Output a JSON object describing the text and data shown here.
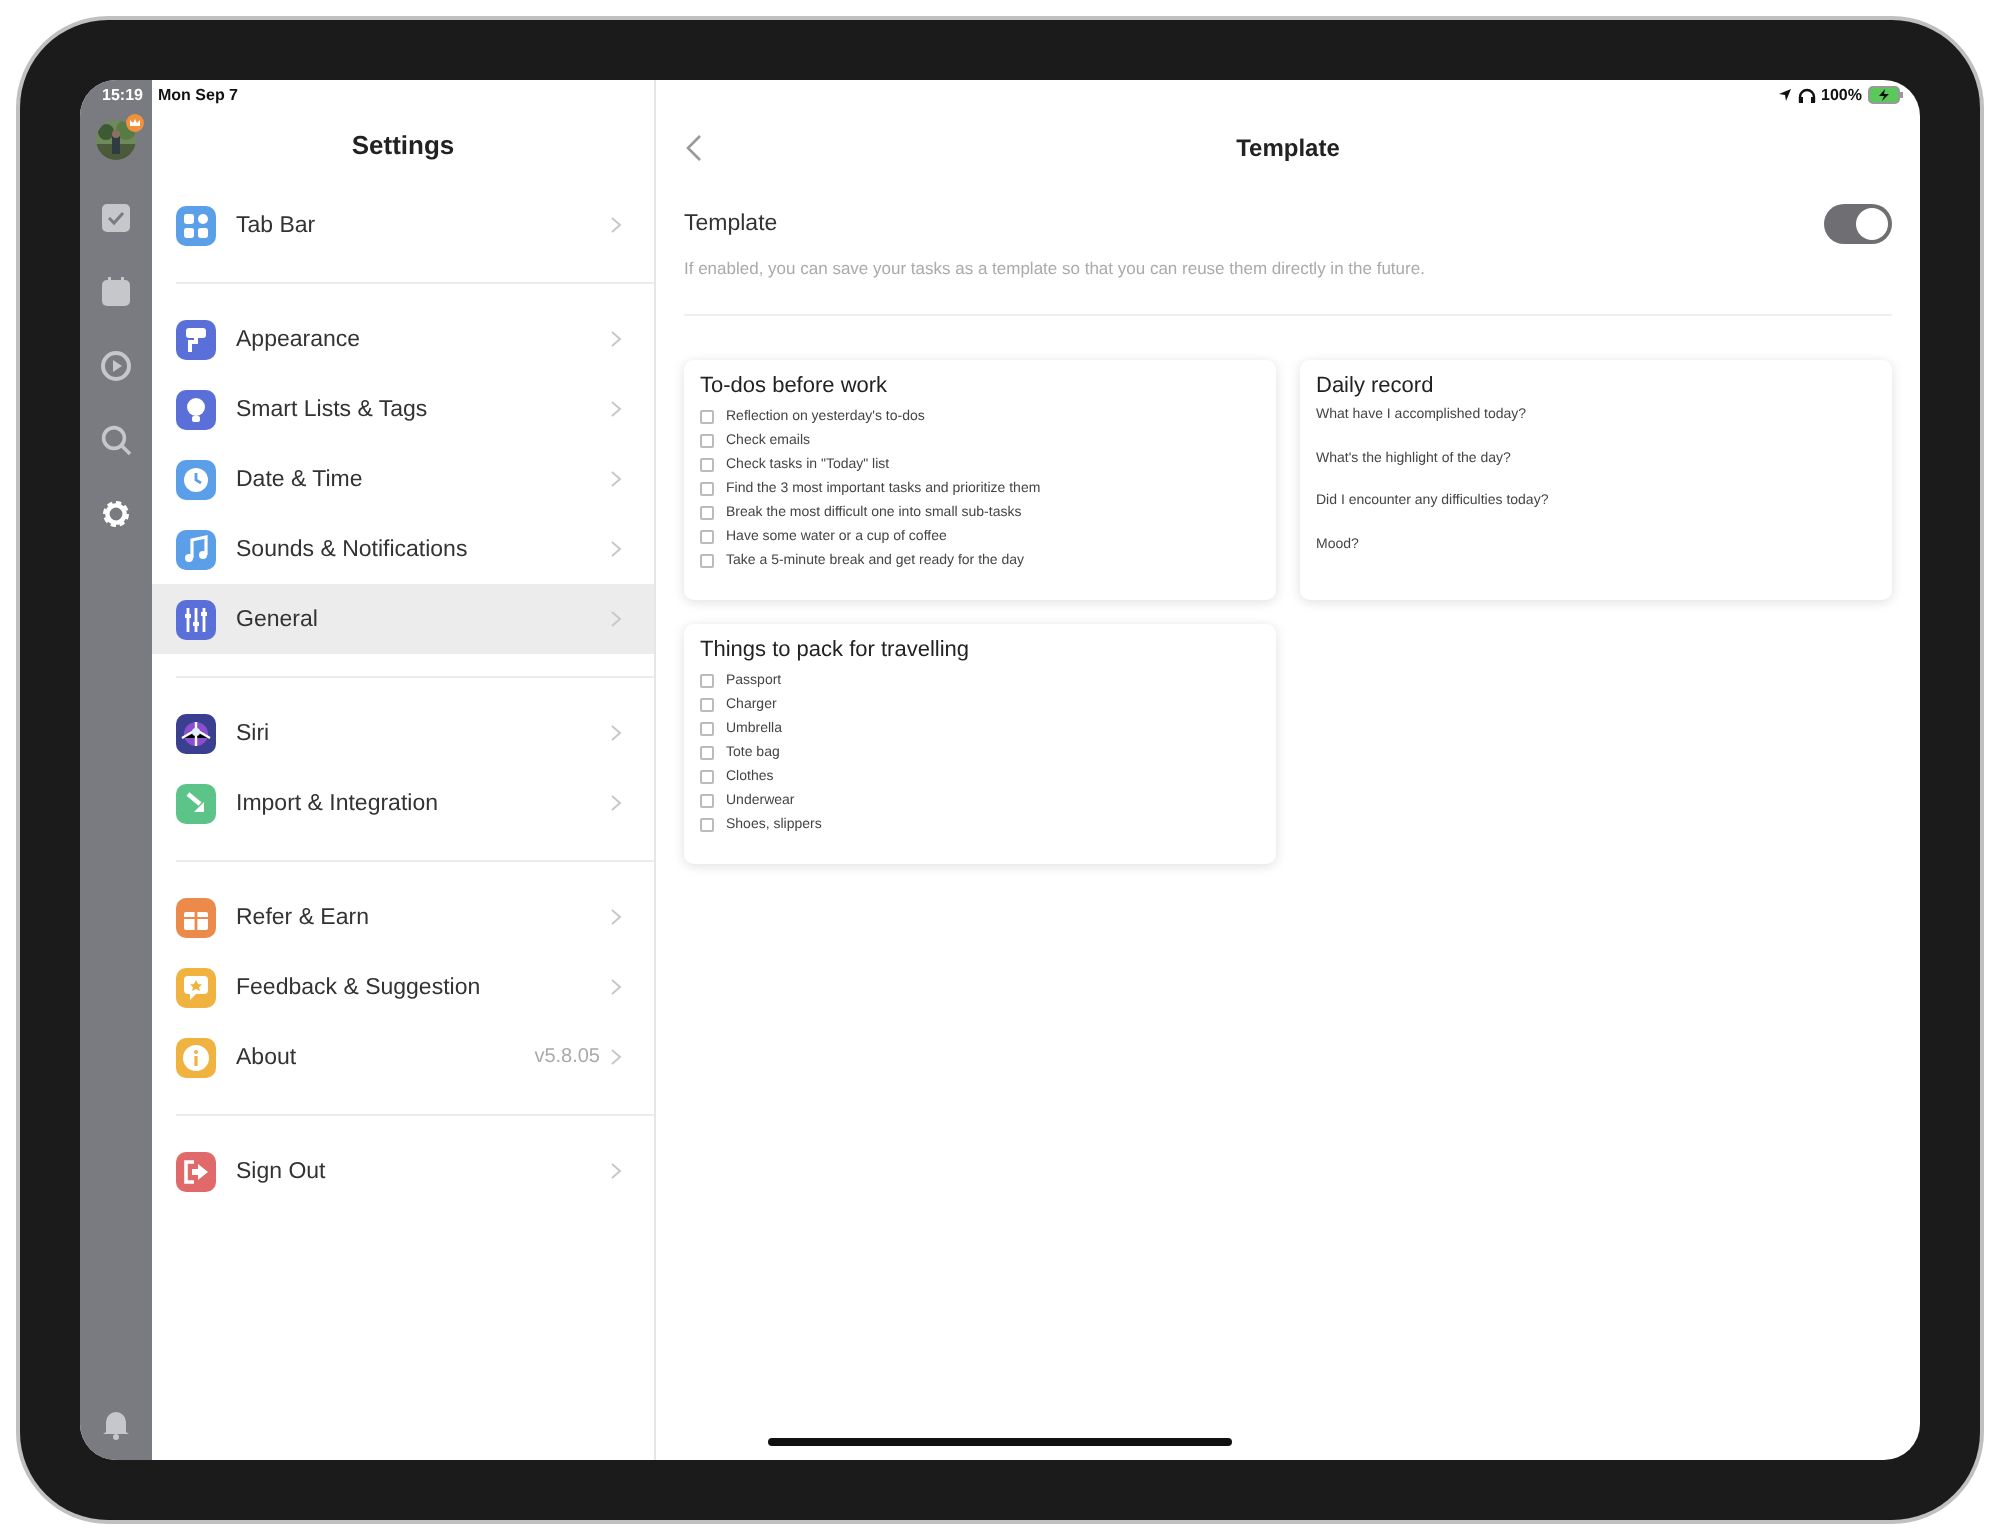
{
  "status_bar": {
    "time": "15:19",
    "date": "Mon Sep 7",
    "battery": "100%"
  },
  "rail": [
    {
      "selected": false
    },
    {
      "selected": false
    },
    {
      "selected": false
    },
    {
      "selected": false
    },
    {
      "selected": true
    }
  ],
  "sidebar": {
    "title": "Settings",
    "groups": [
      {
        "items": [
          {
            "label": "Tab Bar",
            "color": "#5b9fe8",
            "selected": false
          }
        ]
      },
      {
        "items": [
          {
            "label": "Appearance",
            "color": "#5b6fd8",
            "selected": false
          },
          {
            "label": "Smart Lists & Tags",
            "color": "#5b6fd8",
            "selected": false
          },
          {
            "label": "Date & Time",
            "color": "#5b9fe8",
            "selected": false
          },
          {
            "label": "Sounds & Notifications",
            "color": "#5b9fe8",
            "selected": false
          },
          {
            "label": "General",
            "color": "#5b6fd8",
            "selected": true
          }
        ]
      },
      {
        "items": [
          {
            "label": "Siri",
            "color": "#3a3f8f",
            "selected": false
          },
          {
            "label": "Import & Integration",
            "color": "#5cc488",
            "selected": false
          }
        ]
      },
      {
        "items": [
          {
            "label": "Refer & Earn",
            "color": "#ec8a4c",
            "selected": false
          },
          {
            "label": "Feedback & Suggestion",
            "color": "#f0b340",
            "selected": false
          },
          {
            "label": "About",
            "color": "#f0b340",
            "selected": false,
            "value": "v5.8.05"
          }
        ]
      },
      {
        "items": [
          {
            "label": "Sign Out",
            "color": "#e06a6a",
            "selected": false
          }
        ]
      }
    ]
  },
  "detail": {
    "title": "Template",
    "setting": {
      "label": "Template",
      "on": true,
      "description": "If enabled, you can save your tasks as a template so that you can reuse them directly in the future."
    },
    "cards": [
      {
        "kind": "checklist",
        "title": "To-dos before work",
        "items": [
          {
            "text": "Reflection on yesterday's to-dos",
            "checked": false
          },
          {
            "text": "Check emails",
            "checked": false
          },
          {
            "text": "Check tasks in \"Today\" list",
            "checked": false
          },
          {
            "text": "Find the 3 most important tasks and prioritize them",
            "checked": false
          },
          {
            "text": "Break the most difficult one into small sub-tasks",
            "checked": false
          },
          {
            "text": "Have some water or a cup of coffee",
            "checked": false
          },
          {
            "text": "Take a 5-minute break and get ready for the day",
            "checked": false
          }
        ]
      },
      {
        "kind": "notes",
        "title": "Daily record",
        "items": [
          {
            "text": "What have I accomplished today?"
          },
          {
            "text": "What's the highlight of the day?"
          },
          {
            "text": "Did I encounter any difficulties today?"
          },
          {
            "text": "Mood?"
          }
        ]
      },
      {
        "kind": "checklist",
        "title": "Things to pack for travelling",
        "items": [
          {
            "text": "Passport",
            "checked": false
          },
          {
            "text": "Charger",
            "checked": false
          },
          {
            "text": "Umbrella",
            "checked": false
          },
          {
            "text": "Tote bag",
            "checked": false
          },
          {
            "text": "Clothes",
            "checked": false
          },
          {
            "text": "Underwear",
            "checked": false
          },
          {
            "text": "Shoes, slippers",
            "checked": false
          }
        ]
      }
    ]
  }
}
